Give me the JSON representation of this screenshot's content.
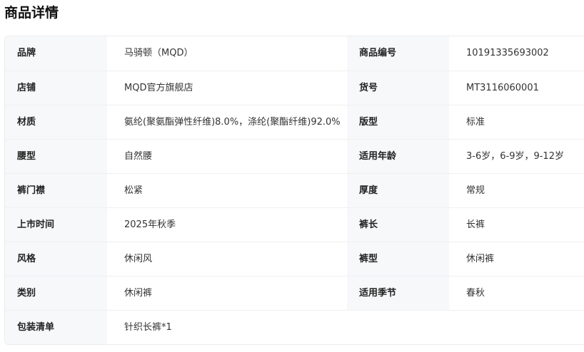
{
  "section": {
    "title": "商品详情"
  },
  "rows": [
    {
      "label1": "品牌",
      "value1": "马骑顿（MQD）",
      "label2": "商品编号",
      "value2": "10191335693002"
    },
    {
      "label1": "店铺",
      "value1": "MQD官方旗舰店",
      "label2": "货号",
      "value2": "MT3116060001"
    },
    {
      "label1": "材质",
      "value1": "氨纶(聚氨酯弹性纤维)8.0%，涤纶(聚酯纤维)92.0%",
      "label2": "版型",
      "value2": "标准"
    },
    {
      "label1": "腰型",
      "value1": "自然腰",
      "label2": "适用年龄",
      "value2": "3-6岁，6-9岁，9-12岁"
    },
    {
      "label1": "裤门襟",
      "value1": "松紧",
      "label2": "厚度",
      "value2": "常规"
    },
    {
      "label1": "上市时间",
      "value1": "2025年秋季",
      "label2": "裤长",
      "value2": "长裤"
    },
    {
      "label1": "风格",
      "value1": "休闲风",
      "label2": "裤型",
      "value2": "休闲裤"
    },
    {
      "label1": "类别",
      "value1": "休闲裤",
      "label2": "适用季节",
      "value2": "春秋"
    },
    {
      "label1": "包装清单",
      "value1": "针织长裤*1"
    }
  ]
}
